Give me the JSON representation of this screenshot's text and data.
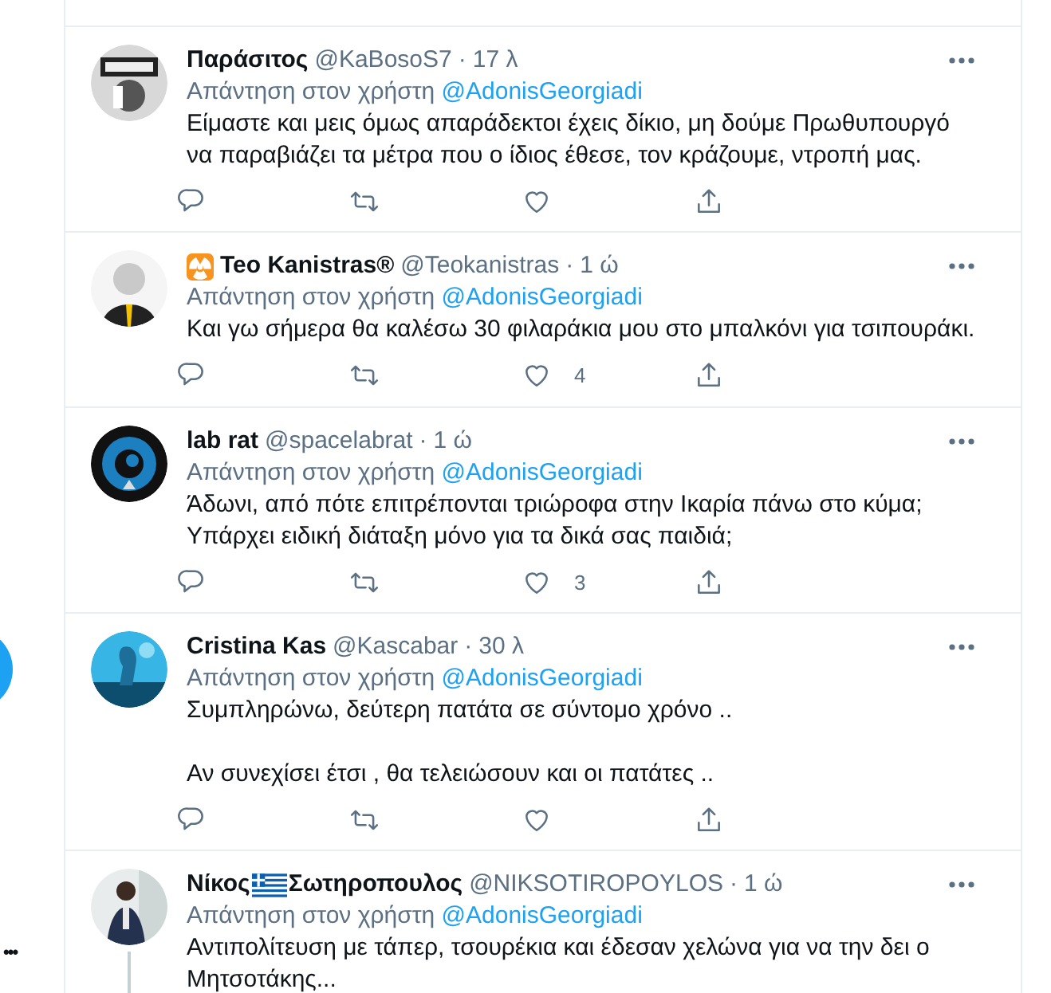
{
  "sidebar": {
    "more_label": "•••"
  },
  "tweets": [
    {
      "name": [
        {
          "kind": "text",
          "text": "Παράσιτος"
        }
      ],
      "handle": "@KaBosoS7",
      "separator": "·",
      "time": "17 λ",
      "reply_prefix": "Απάντηση στον χρήστη",
      "reply_to": "@AdonisGeorgiadi",
      "paragraphs": [
        {
          "text": "Είμαστε και μεις όμως απαράδεκτοι έχεις δίκιο, μη δούμε Πρωθυπουργό να παραβιάζει τα μέτρα που ο ίδιος έθεσε, τον κράζουμε, ντροπή μας.",
          "gap_before": false
        }
      ],
      "thread_line": false
    },
    {
      "name": [
        {
          "kind": "radioactive"
        },
        {
          "kind": "text",
          "text": "Teo Kanistras®"
        }
      ],
      "handle": "@Teokanistras",
      "separator": "·",
      "time": "1 ώ",
      "reply_prefix": "Απάντηση στον χρήστη",
      "reply_to": "@AdonisGeorgiadi",
      "paragraphs": [
        {
          "text": "Και γω σήμερα θα καλέσω 30 φιλαράκια μου στο μπαλκόνι για τσιπουράκι.",
          "gap_before": false
        }
      ],
      "likes": "4",
      "thread_line": false
    },
    {
      "name": [
        {
          "kind": "text",
          "text": "lab rat"
        }
      ],
      "handle": "@spacelabrat",
      "separator": "·",
      "time": "1 ώ",
      "reply_prefix": "Απάντηση στον χρήστη",
      "reply_to": "@AdonisGeorgiadi",
      "paragraphs": [
        {
          "text": "Άδωνι, από πότε επιτρέπονται τριώροφα στην Ικαρία πάνω στο κύμα;",
          "gap_before": false
        },
        {
          "text": "Υπάρχει ειδική διάταξη μόνο για τα δικά σας παιδιά;",
          "gap_before": false
        }
      ],
      "likes": "3",
      "thread_line": false
    },
    {
      "name": [
        {
          "kind": "text",
          "text": "Cristina Kas"
        }
      ],
      "handle": "@Kascabar",
      "separator": "·",
      "time": "30 λ",
      "reply_prefix": "Απάντηση στον χρήστη",
      "reply_to": "@AdonisGeorgiadi",
      "paragraphs": [
        {
          "text": "Συμπληρώνω, δεύτερη πατάτα σε σύντομο χρόνο ..",
          "gap_before": false
        },
        {
          "text": "Αν συνεχίσει έτσι , θα τελειώσουν και οι πατάτες ..",
          "gap_before": true
        }
      ],
      "thread_line": false
    },
    {
      "name": [
        {
          "kind": "text",
          "text": "Νίκος"
        },
        {
          "kind": "flag"
        },
        {
          "kind": "text",
          "text": "Σωτηροπουλος"
        }
      ],
      "handle": "@NIKSOTIROPOYLOS",
      "separator": "·",
      "time": "1 ώ",
      "reply_prefix": "Απάντηση στον χρήστη",
      "reply_to": "@AdonisGeorgiadi",
      "paragraphs": [
        {
          "text": "Αντιπολίτευση με τάπερ, τσουρέκια και έδεσαν χελώνα για να την δει ο Μητσοτάκης...",
          "gap_before": false
        }
      ],
      "thread_line": true
    }
  ]
}
